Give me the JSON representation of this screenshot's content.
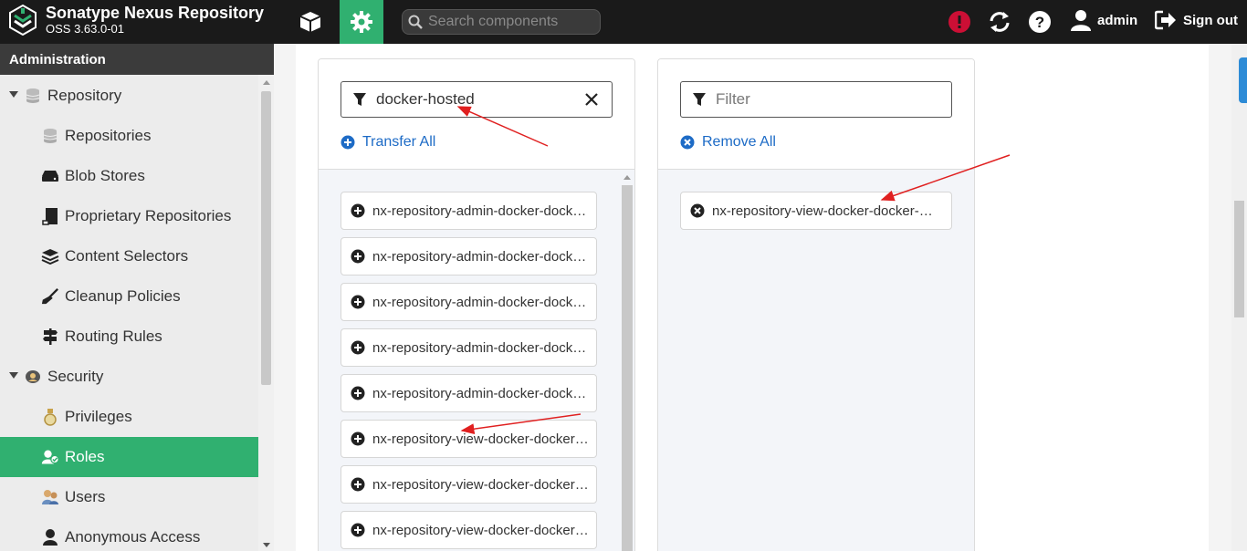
{
  "header": {
    "title": "Sonatype Nexus Repository",
    "version": "OSS 3.63.0-01",
    "search_placeholder": "Search components",
    "user": "admin",
    "signout": "Sign out"
  },
  "sidebar": {
    "heading": "Administration",
    "items": [
      {
        "label": "Repository",
        "icon": "database-icon"
      },
      {
        "label": "Repositories",
        "icon": "database-icon"
      },
      {
        "label": "Blob Stores",
        "icon": "hard-drive-icon"
      },
      {
        "label": "Proprietary Repositories",
        "icon": "book-icon"
      },
      {
        "label": "Content Selectors",
        "icon": "layers-icon"
      },
      {
        "label": "Cleanup Policies",
        "icon": "broom-icon"
      },
      {
        "label": "Routing Rules",
        "icon": "signpost-icon"
      },
      {
        "label": "Security",
        "icon": "badge-icon"
      },
      {
        "label": "Privileges",
        "icon": "medal-icon"
      },
      {
        "label": "Roles",
        "icon": "user-group-icon"
      },
      {
        "label": "Users",
        "icon": "users-icon"
      },
      {
        "label": "Anonymous Access",
        "icon": "user-icon"
      }
    ]
  },
  "available": {
    "filter_value": "docker-hosted",
    "transfer_label": "Transfer All",
    "items": [
      "nx-repository-admin-docker-docker-hosted-add",
      "nx-repository-admin-docker-docker-hosted-browse",
      "nx-repository-admin-docker-docker-hosted-delete",
      "nx-repository-admin-docker-docker-hosted-edit",
      "nx-repository-admin-docker-docker-hosted-read",
      "nx-repository-view-docker-docker-hosted-*",
      "nx-repository-view-docker-docker-hosted-add",
      "nx-repository-view-docker-docker-hosted-browse"
    ]
  },
  "given": {
    "filter_placeholder": "Filter",
    "remove_label": "Remove All",
    "items": [
      "nx-repository-view-docker-docker-hosted-*"
    ]
  },
  "colors": {
    "accent": "#30b070",
    "link": "#1d6bc6",
    "header": "#1a1a1a",
    "alert": "#cc0f35",
    "annotation": "#e02020"
  }
}
